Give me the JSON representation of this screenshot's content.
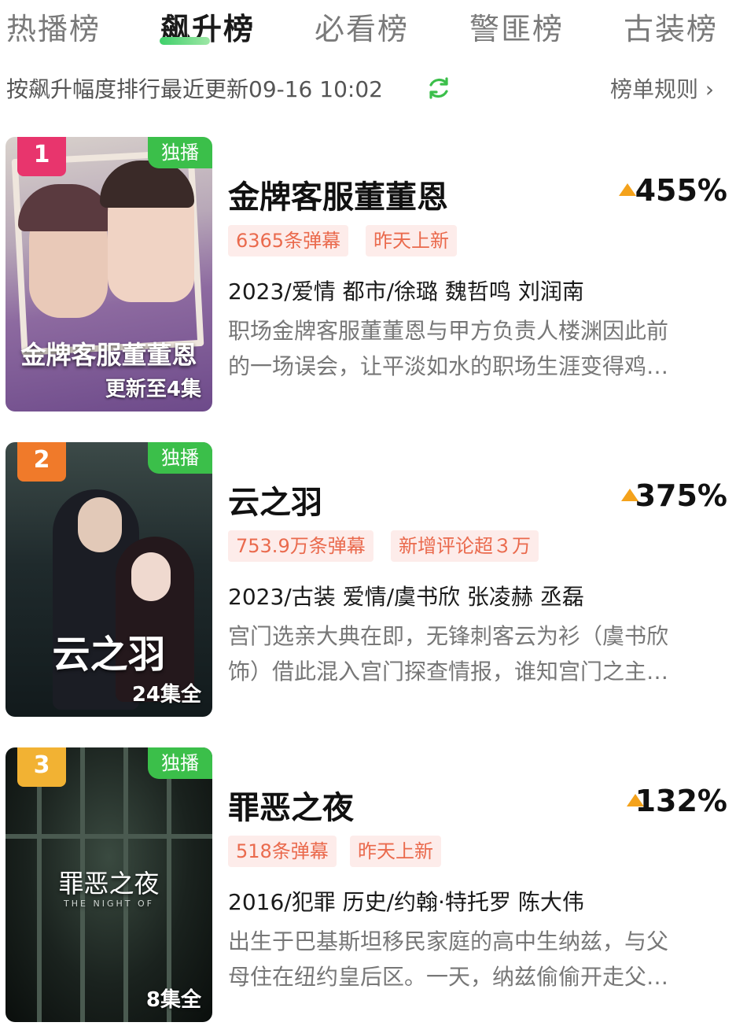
{
  "tabs": [
    {
      "label": "热播榜",
      "active": false
    },
    {
      "label": "飙升榜",
      "active": true
    },
    {
      "label": "必看榜",
      "active": false
    },
    {
      "label": "警匪榜",
      "active": false
    },
    {
      "label": "古装榜",
      "active": false
    }
  ],
  "subheader": {
    "text": "按飙升幅度排行最近更新09-16 10:02",
    "rules_label": "榜单规则 ›"
  },
  "items": [
    {
      "rank": "1",
      "badge": "独播",
      "poster_title": "金牌客服董董恩",
      "episodes": "更新至4集",
      "title": "金牌客服董董恩",
      "change": "455%",
      "tags": [
        "6365条弹幕",
        "昨天上新"
      ],
      "meta": "2023/爱情 都市/徐璐 魏哲鸣 刘润南",
      "desc": [
        "职场金牌客服董董恩与甲方负责人楼渊因此前",
        "的一场误会，让平淡如水的职场生涯变得鸡…"
      ]
    },
    {
      "rank": "2",
      "badge": "独播",
      "poster_title": "云之羽",
      "episodes": "24集全",
      "title": "云之羽",
      "change": "375%",
      "tags": [
        "753.9万条弹幕",
        "新增评论超３万"
      ],
      "meta": "2023/古装 爱情/虞书欣 张凌赫 丞磊",
      "desc": [
        "宫门选亲大典在即，无锋刺客云为衫（虞书欣",
        "饰）借此混入宫门探查情报，谁知宫门之主…"
      ]
    },
    {
      "rank": "3",
      "badge": "独播",
      "poster_title": "罪恶之夜",
      "poster_subtitle": "THE NIGHT OF",
      "episodes": "8集全",
      "title": "罪恶之夜",
      "change": "132%",
      "tags": [
        "518条弹幕",
        "昨天上新"
      ],
      "meta": "2016/犯罪 历史/约翰·特托罗 陈大伟",
      "desc": [
        "出生于巴基斯坦移民家庭的高中生纳兹，与父",
        "母住在纽约皇后区。一天，纳兹偷偷开走父…"
      ]
    }
  ],
  "colors": {
    "accent_green": "#3bbf4a",
    "rank1": "#e8356d",
    "rank2": "#f07a2a",
    "rank3": "#f2b233",
    "up_arrow": "#f4a21b",
    "tag_text": "#ea6a4d",
    "tag_bg": "#fdecea"
  }
}
